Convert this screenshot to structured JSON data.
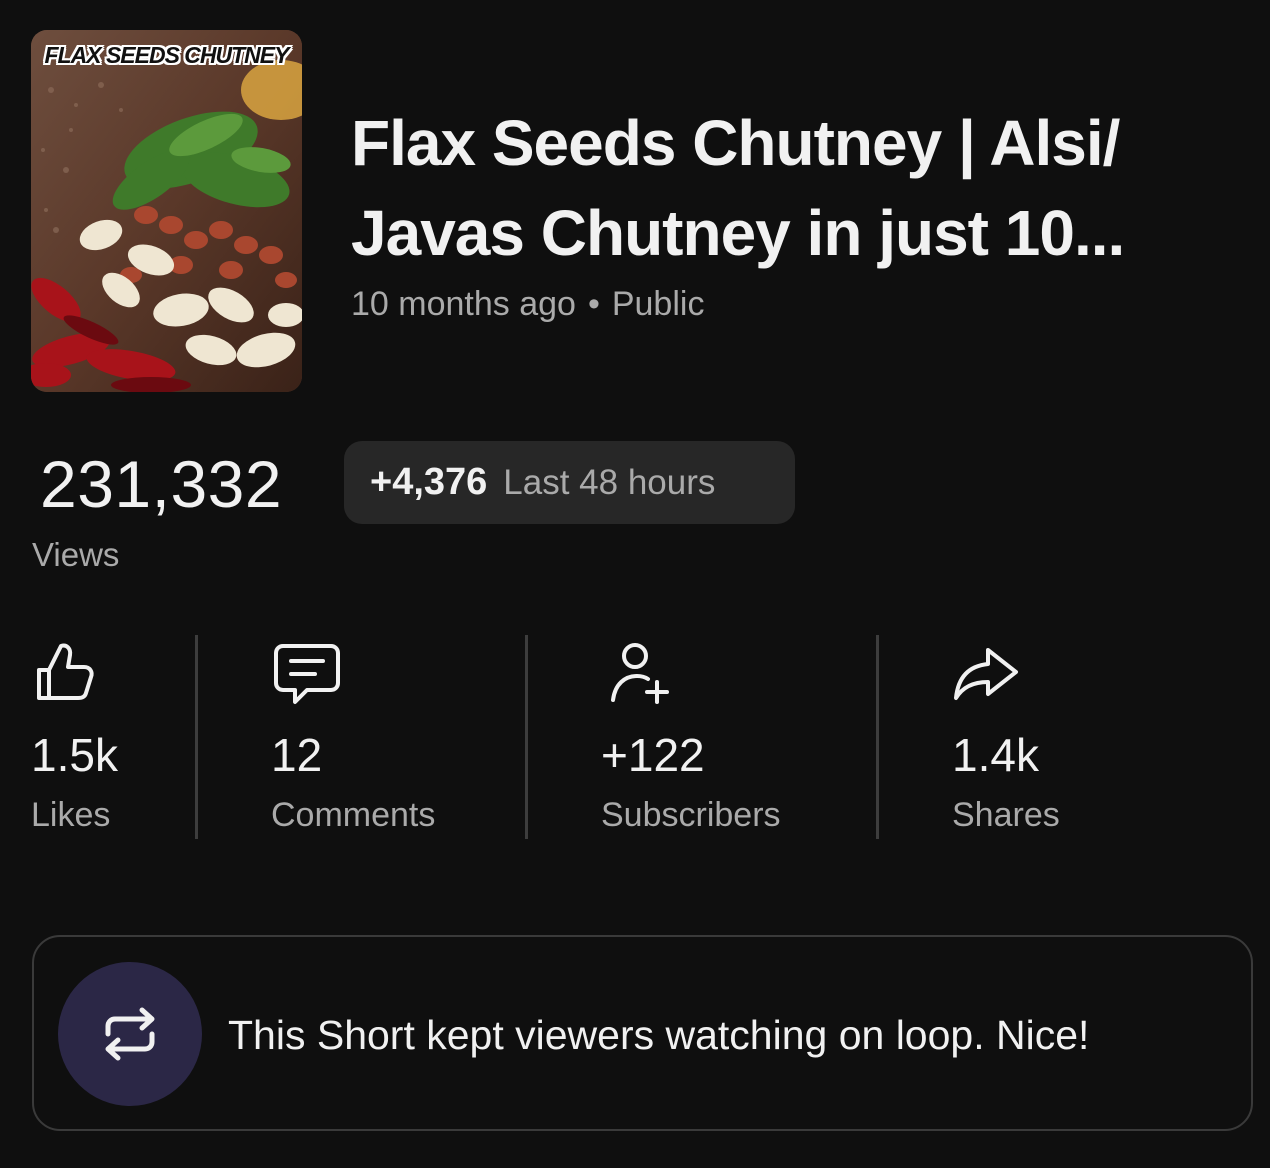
{
  "video": {
    "thumbnail_caption": "FLAX SEEDS CHUTNEY",
    "title": "Flax Seeds Chutney | Alsi/ Javas Chutney in just 10...",
    "age": "10 months ago",
    "separator": "•",
    "visibility": "Public"
  },
  "views": {
    "count": "231,332",
    "label": "Views",
    "recent_delta": "+4,376",
    "recent_label": "Last 48 hours"
  },
  "stats": [
    {
      "icon": "thumbs-up-icon",
      "value": "1.5k",
      "label": "Likes"
    },
    {
      "icon": "comment-icon",
      "value": "12",
      "label": "Comments"
    },
    {
      "icon": "add-person-icon",
      "value": "+122",
      "label": "Subscribers"
    },
    {
      "icon": "share-icon",
      "value": "1.4k",
      "label": "Shares"
    }
  ],
  "insight": {
    "icon": "loop-icon",
    "text": "This Short kept viewers watching on loop. Nice!"
  },
  "colors": {
    "background": "#0f0f0f",
    "chip_background": "#272727",
    "secondary_text": "#aaaaaa",
    "loop_icon_background": "#2b2746"
  }
}
